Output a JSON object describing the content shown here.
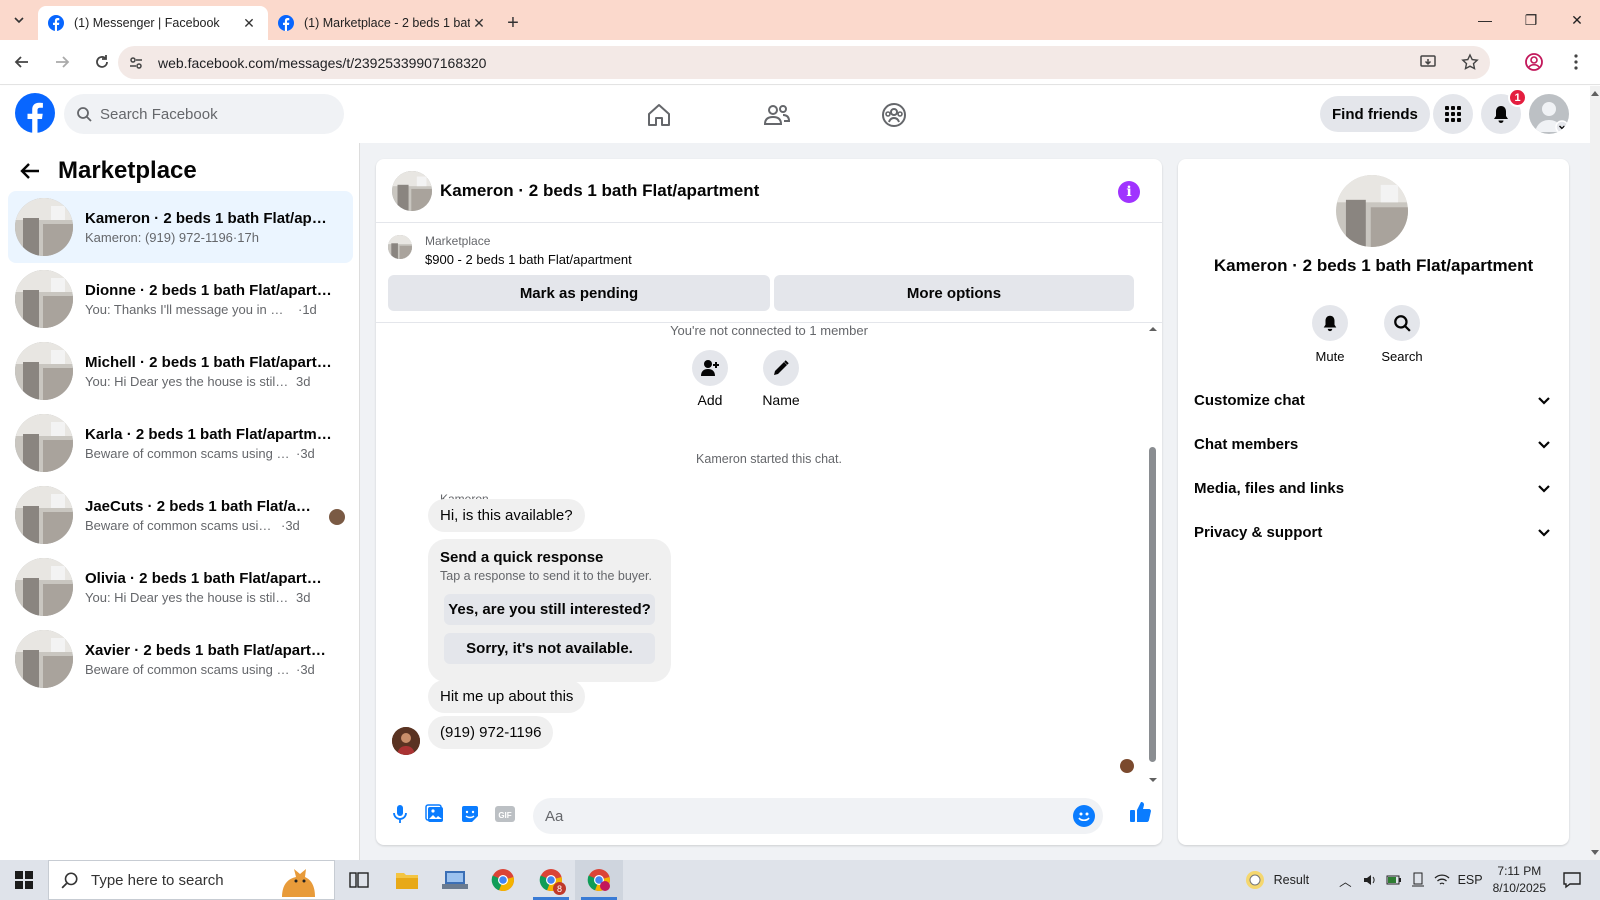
{
  "browser": {
    "tabs": [
      {
        "title": "(1) Messenger | Facebook",
        "active": true
      },
      {
        "title": "(1) Marketplace - 2 beds 1 bath",
        "active": false
      }
    ],
    "url": "web.facebook.com/messages/t/23925339907168320"
  },
  "fb_header": {
    "search_placeholder": "Search Facebook",
    "find_friends_label": "Find friends",
    "notification_count": "1"
  },
  "left_pane": {
    "title": "Marketplace",
    "conversations": [
      {
        "name": "Kameron · 2 beds 1 bath Flat/apart...",
        "preview": "Kameron: (919) 972-1196",
        "time": "·17h",
        "selected": true
      },
      {
        "name": "Dionne · 2 beds 1 bath Flat/apartm...",
        "preview": "You: Thanks I'll message you in a mo...",
        "time": "·1d"
      },
      {
        "name": "Michell · 2 beds 1 bath Flat/apartm...",
        "preview": "You: Hi Dear yes the house is still avail...",
        "time": "3d"
      },
      {
        "name": "Karla · 2 beds 1 bath Flat/apartment",
        "preview": "Beware of common scams using pay...",
        "time": "·3d"
      },
      {
        "name": "JaeCuts · 2 beds 1 bath Flat/apar...",
        "preview": "Beware of common scams using p...",
        "time": "·3d"
      },
      {
        "name": "Olivia · 2 beds 1 bath Flat/apartment",
        "preview": "You: Hi Dear yes the house is still avail...",
        "time": "3d"
      },
      {
        "name": "Xavier · 2 beds 1 bath Flat/apartm...",
        "preview": "Beware of common scams using pay...",
        "time": "·3d"
      }
    ]
  },
  "chat": {
    "title": "Kameron · 2 beds 1 bath Flat/apartment",
    "listing_source": "Marketplace",
    "listing_text": "$900 - 2 beds 1 bath Flat/apartment",
    "mark_pending_label": "Mark as pending",
    "more_options_label": "More options",
    "not_connected_note": "You're not connected to 1 member",
    "add_label": "Add",
    "name_label": "Name",
    "started_note": "Kameron started this chat.",
    "sender_name": "Kameron",
    "msg1": "Hi, is this available?",
    "quick_response_title": "Send a quick response",
    "quick_response_sub": "Tap a response to send it to the buyer.",
    "quick_opt1": "Yes, are you still interested?",
    "quick_opt2": "Sorry, it's not available.",
    "msg2": "Hit me up about this",
    "msg3": "(919) 972-1196",
    "composer_placeholder": "Aa",
    "accent_color": "#0a7cff"
  },
  "info_panel": {
    "name": "Kameron · 2 beds 1 bath Flat/apartment",
    "mute_label": "Mute",
    "search_label": "Search",
    "sections": [
      "Customize chat",
      "Chat members",
      "Media, files and links",
      "Privacy & support"
    ]
  },
  "taskbar": {
    "search_placeholder": "Type here to search",
    "weather_label": "Result",
    "language": "ESP",
    "time": "7:11 PM",
    "date": "8/10/2025",
    "chrome_badge": "8"
  }
}
